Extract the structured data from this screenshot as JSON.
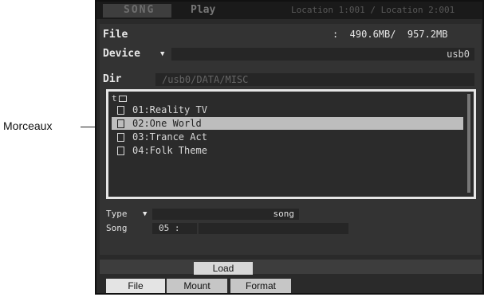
{
  "callout": {
    "label": "Morceaux"
  },
  "header": {
    "mode_tab": "SONG",
    "play_tab": "Play",
    "location": "Location 1:001 / Location 2:001"
  },
  "file": {
    "label": "File",
    "memory": ":  490.6MB/  957.2MB"
  },
  "device": {
    "label": "Device",
    "value": "usb0"
  },
  "dir": {
    "label": "Dir",
    "path": "/usb0/DATA/MISC"
  },
  "list": {
    "up_marker": "t",
    "items": [
      {
        "label": "01:Reality TV",
        "selected": false
      },
      {
        "label": "02:One World",
        "selected": true
      },
      {
        "label": "03:Trance Act",
        "selected": false
      },
      {
        "label": "04:Folk Theme",
        "selected": false
      }
    ]
  },
  "type": {
    "label": "Type",
    "value": "song"
  },
  "song": {
    "label": "Song",
    "number": "05",
    "name_sep": ":"
  },
  "action": {
    "load_label": "Load"
  },
  "tabs": [
    {
      "label": "File"
    },
    {
      "label": "Mount"
    },
    {
      "label": "Format"
    }
  ]
}
